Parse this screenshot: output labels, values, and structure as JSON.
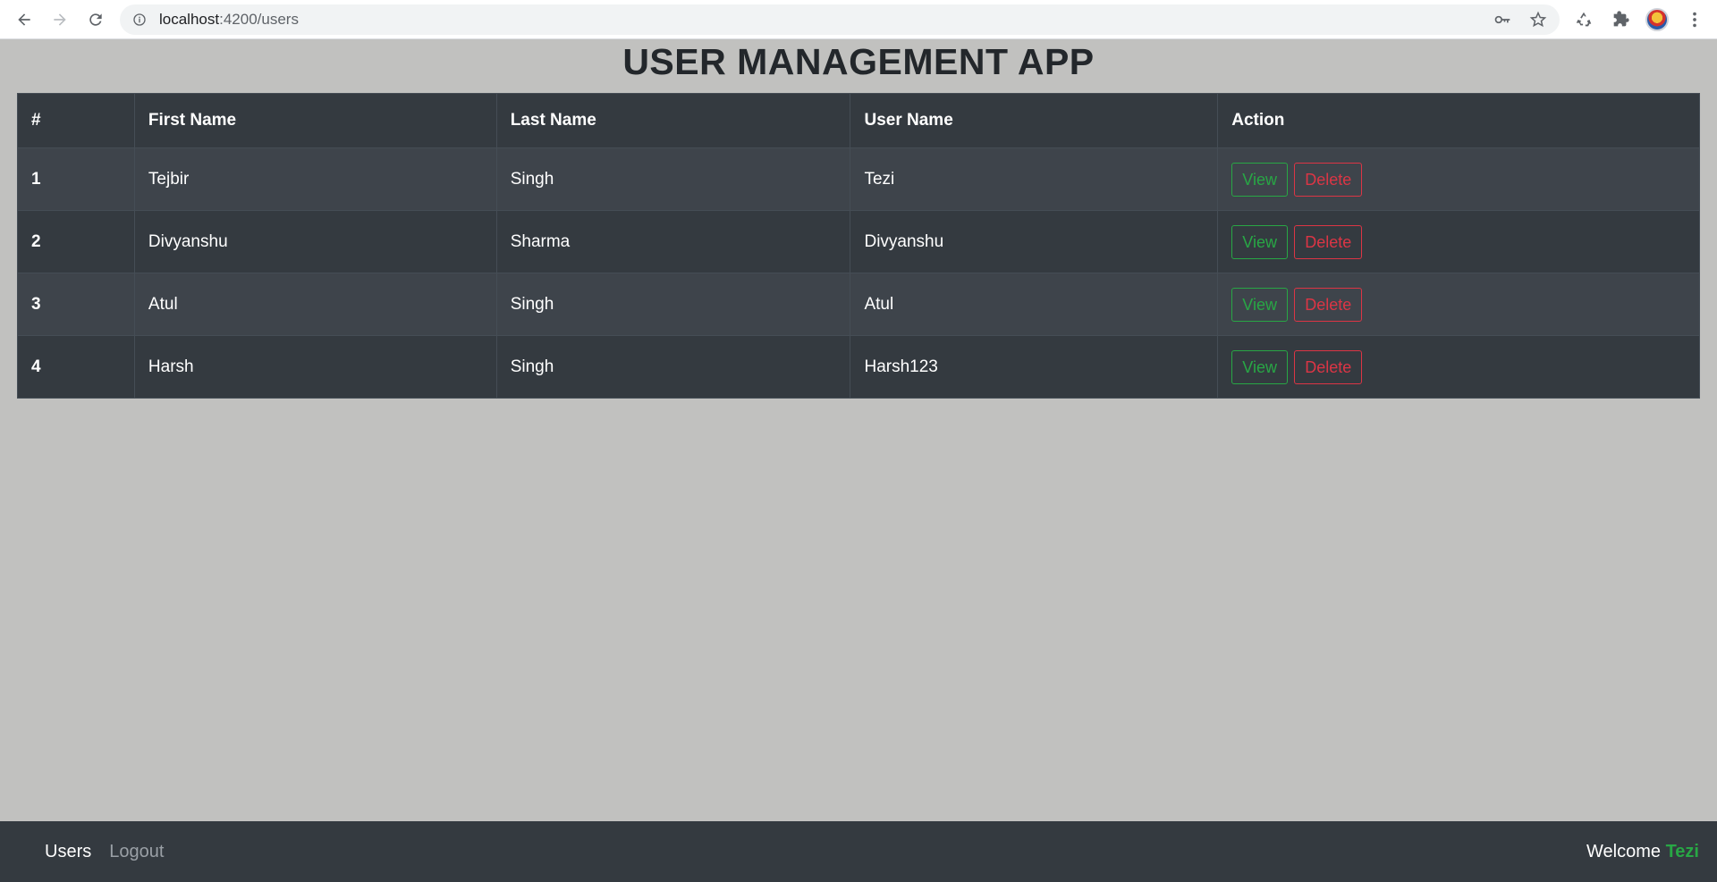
{
  "browser": {
    "url_host": "localhost",
    "url_path": ":4200/users"
  },
  "page": {
    "title": "USER MANAGEMENT APP"
  },
  "table": {
    "headers": [
      "#",
      "First Name",
      "Last Name",
      "User Name",
      "Action"
    ],
    "rows": [
      {
        "id": "1",
        "first": "Tejbir",
        "last": "Singh",
        "username": "Tezi"
      },
      {
        "id": "2",
        "first": "Divyanshu",
        "last": "Sharma",
        "username": "Divyanshu"
      },
      {
        "id": "3",
        "first": "Atul",
        "last": "Singh",
        "username": "Atul"
      },
      {
        "id": "4",
        "first": "Harsh",
        "last": "Singh",
        "username": "Harsh123"
      }
    ],
    "view_label": "View",
    "delete_label": "Delete"
  },
  "footer": {
    "nav": [
      "Users",
      "Logout"
    ],
    "welcome_prefix": "Welcome",
    "username": "Tezi"
  },
  "colors": {
    "accent_green": "#28a745",
    "danger_red": "#dc3545",
    "dark_bg": "#343a40",
    "page_bg": "#c1c1bf"
  }
}
